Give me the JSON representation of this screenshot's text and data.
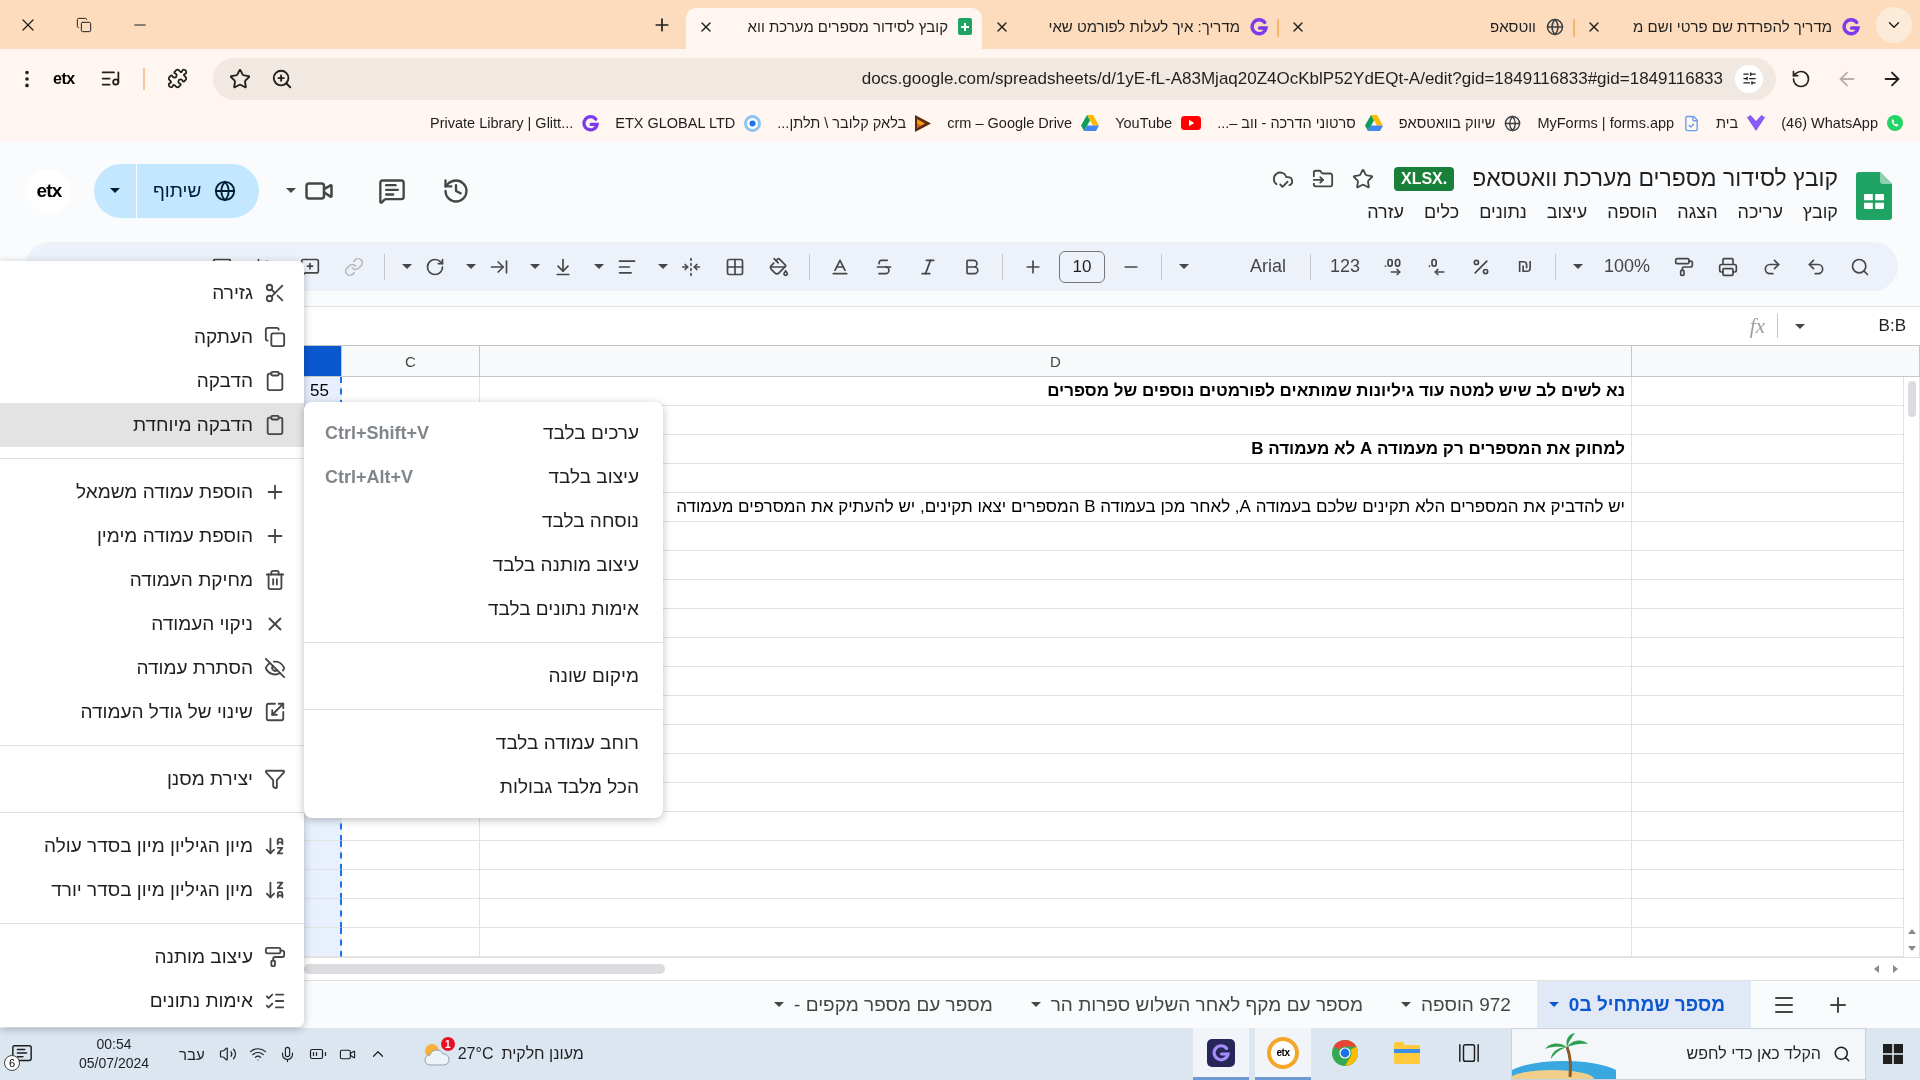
{
  "browser": {
    "tabs": [
      {
        "title": "מדריך להפרדת שם פרטי ושם מ",
        "kind": "glitter",
        "selected": false
      },
      {
        "title": "ווטסאפ",
        "kind": "globe",
        "selected": false
      },
      {
        "title": "מדריך: איך לעלות לפורמט שאי",
        "kind": "glitter",
        "selected": false
      },
      {
        "title": "קובץ לסידור מספרים מערכת ווא",
        "kind": "sheets",
        "selected": true
      }
    ],
    "forward_disabled": true,
    "url": "docs.google.com/spreadsheets/d/1yE-fL-A83Mjaq20Z4OcKblP52YdEQt-A/edit?gid=1849116833#gid=1849116833",
    "extension_logo": "etx",
    "bookmarks": [
      {
        "label": "(46) WhatsApp",
        "kind": "whatsapp"
      },
      {
        "label": "בית",
        "kind": "heart"
      },
      {
        "label": "MyForms | forms.app",
        "kind": "forms"
      },
      {
        "label": "שיווק בוואטסאפ",
        "kind": "globe"
      },
      {
        "label": "סרטוני הדרכה - ווב –...",
        "kind": "drive"
      },
      {
        "label": "YouTube",
        "kind": "youtube"
      },
      {
        "label": "crm – Google Drive",
        "kind": "drive"
      },
      {
        "label": "בלאק קלובר \\ תלתן...",
        "kind": "clover"
      },
      {
        "label": "ETX GLOBAL LTD",
        "kind": "ring"
      },
      {
        "label": "Private Library | Glitt...",
        "kind": "glitter"
      }
    ]
  },
  "sheets": {
    "title": "קובץ לסידור מספרים מערכת וואטסאפ",
    "badge": "XLSX.",
    "menu": [
      "קובץ",
      "עריכה",
      "הצגה",
      "הוספה",
      "עיצוב",
      "נתונים",
      "כלים",
      "עזרה"
    ],
    "share": "שיתוף",
    "account_logo": "etx",
    "toolbar": {
      "zoom": "100%",
      "currency": "₪",
      "number_format": "123",
      "font": "Arial",
      "font_size": "10",
      "link_disabled": true
    },
    "name_box": "B:B",
    "fx": "fx",
    "columns": [
      {
        "selected": false
      },
      {
        "label": "D",
        "selected": false
      },
      {
        "label": "C",
        "selected": false
      },
      {
        "selected": true
      }
    ],
    "rows": [
      {
        "D": {
          "text": "נא לשים לב שיש למטה עוד גיליונות שמותאים לפורמטים נוספים של מספרים",
          "bold": true
        },
        "B": {
          "text": "55",
          "bold": false
        }
      },
      {},
      {
        "D": {
          "text": "למחוק את המספרים רק מעמודה A לא מעמודה B",
          "bold": true
        }
      },
      {},
      {
        "D": {
          "text": "יש להדביק את המספרים הלא תקינים שלכם בעמודה A, לאחר מכן בעמודה B המספרים יצאו תקינים, יש להעתיק את המסרפים מעמודה",
          "bold": false
        }
      }
    ],
    "sheet_tabs": [
      {
        "label": "מספר שמתחיל ב0",
        "selected": true
      },
      {
        "label": "972 הוספה",
        "selected": false
      },
      {
        "label": "מספר עם מקף לאחר השלוש ספרות הר",
        "selected": false
      },
      {
        "label": "מספר עם מספר מקפים -",
        "selected": false
      }
    ]
  },
  "context_menu": {
    "items": [
      {
        "kind": "item",
        "label": "גזירה",
        "selected": false
      },
      {
        "kind": "item",
        "label": "העתקה",
        "selected": false
      },
      {
        "kind": "item",
        "label": "הדבקה",
        "selected": false
      },
      {
        "kind": "item",
        "label": "הדבקה מיוחדת",
        "selected": true
      },
      {
        "kind": "divider"
      },
      {
        "kind": "item",
        "label": "הוספת עמודה משמאל",
        "selected": false
      },
      {
        "kind": "item",
        "label": "הוספת עמודה מימין",
        "selected": false
      },
      {
        "kind": "item",
        "label": "מחיקת העמודה",
        "selected": false
      },
      {
        "kind": "item",
        "label": "ניקוי העמודה",
        "selected": false
      },
      {
        "kind": "item",
        "label": "הסתרת עמודה",
        "selected": false
      },
      {
        "kind": "item",
        "label": "שינוי של גודל העמודה",
        "selected": false
      },
      {
        "kind": "divider"
      },
      {
        "kind": "item",
        "label": "יצירת מסנן",
        "selected": false
      },
      {
        "kind": "divider"
      },
      {
        "kind": "item",
        "label": "מיון הגיליון מיון בסדר עולה",
        "selected": false
      },
      {
        "kind": "item",
        "label": "מיון הגיליון מיון בסדר יורד",
        "selected": false
      },
      {
        "kind": "divider"
      },
      {
        "kind": "item",
        "label": "עיצוב מותנה",
        "selected": false
      },
      {
        "kind": "item",
        "label": "אימות נתונים",
        "selected": false
      }
    ]
  },
  "paste_special_menu": {
    "items": [
      {
        "kind": "item",
        "label": "ערכים בלבד",
        "shortcut": "Ctrl+Shift+V"
      },
      {
        "kind": "item",
        "label": "עיצוב בלבד",
        "shortcut": "Ctrl+Alt+V"
      },
      {
        "kind": "item",
        "label": "נוסחה בלבד"
      },
      {
        "kind": "item",
        "label": "עיצוב מותנה בלבד"
      },
      {
        "kind": "item",
        "label": "אימות נתונים בלבד"
      },
      {
        "kind": "divider"
      },
      {
        "kind": "item",
        "label": "מיקום שונה"
      },
      {
        "kind": "divider"
      },
      {
        "kind": "item",
        "label": "רוחב עמודה בלבד"
      },
      {
        "kind": "item",
        "label": "הכל מלבד גבולות"
      }
    ]
  },
  "taskbar": {
    "search_placeholder": "הקלד כאן כדי לחפש",
    "apps": [
      {
        "kind": "explorer",
        "active": false
      },
      {
        "kind": "chrome",
        "active": false
      },
      {
        "kind": "etx",
        "label": "etx",
        "active": true
      },
      {
        "kind": "glitter",
        "active": true
      }
    ],
    "weather": {
      "condition": "מעונן חלקית",
      "temperature": "27°C",
      "badge": "1"
    },
    "language": "עבר",
    "time": "00:54",
    "date": "05/07/2024",
    "notification_count": "6"
  }
}
